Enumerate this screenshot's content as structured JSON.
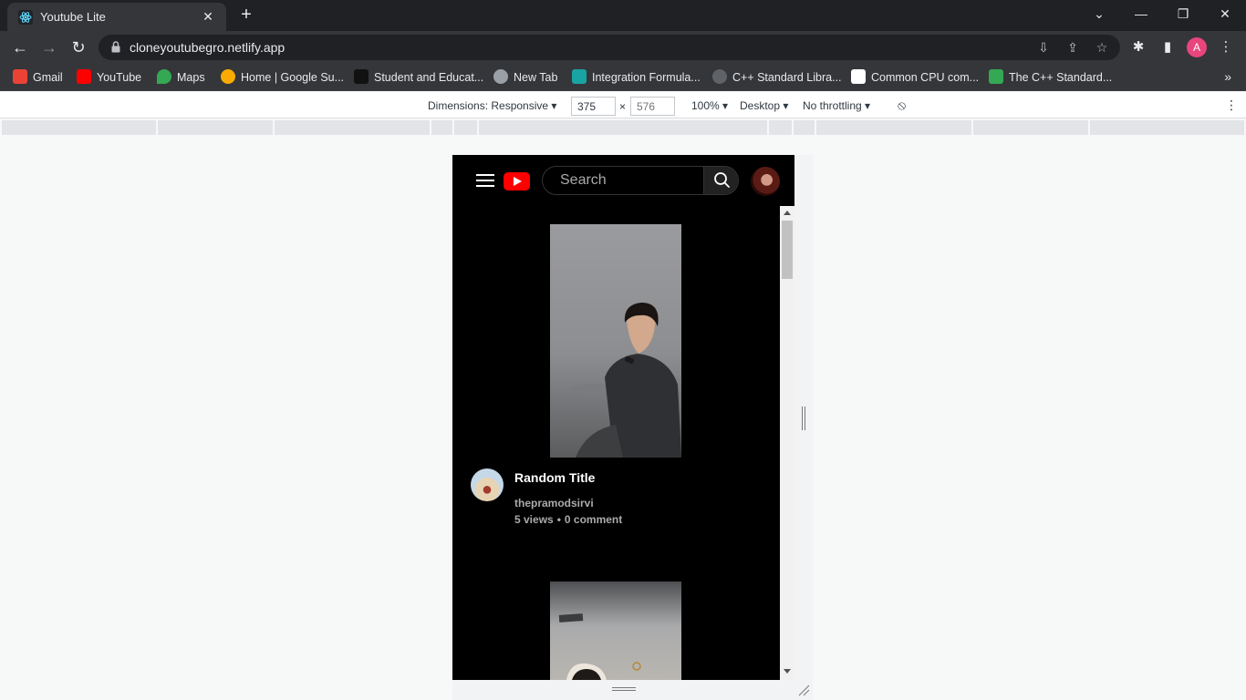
{
  "browser": {
    "tab_title": "Youtube Lite",
    "url": "cloneyoutubegro.netlify.app",
    "profile_initial": "A",
    "bookmarks": [
      {
        "label": "Gmail",
        "color": "#ea4335"
      },
      {
        "label": "YouTube",
        "color": "#ff0000"
      },
      {
        "label": "Maps",
        "color": "#34a853"
      },
      {
        "label": "Home | Google Su...",
        "color": "#f9ab00"
      },
      {
        "label": "Student and Educat...",
        "color": "#111111"
      },
      {
        "label": "New Tab",
        "color": "#9aa0a6"
      },
      {
        "label": "Integration Formula...",
        "color": "#1aa3a3"
      },
      {
        "label": "C++ Standard Libra...",
        "color": "#5f6368"
      },
      {
        "label": "Common CPU com...",
        "color": "#ffffff"
      },
      {
        "label": "The C++ Standard...",
        "color": "#34a853"
      }
    ]
  },
  "devtools": {
    "dimensions_label": "Dimensions: Responsive",
    "width": "375",
    "height_placeholder": "576",
    "times": "×",
    "zoom": "100%",
    "device_type": "Desktop",
    "throttling": "No throttling"
  },
  "app": {
    "search_placeholder": "Search",
    "videos": [
      {
        "title": "Random Title",
        "channel": "thepramodsirvi",
        "views": "5 views",
        "dot": "•",
        "comments": "0 comment"
      }
    ]
  },
  "colors": {
    "brand_red": "#ff0000",
    "page_bg": "#000000"
  }
}
